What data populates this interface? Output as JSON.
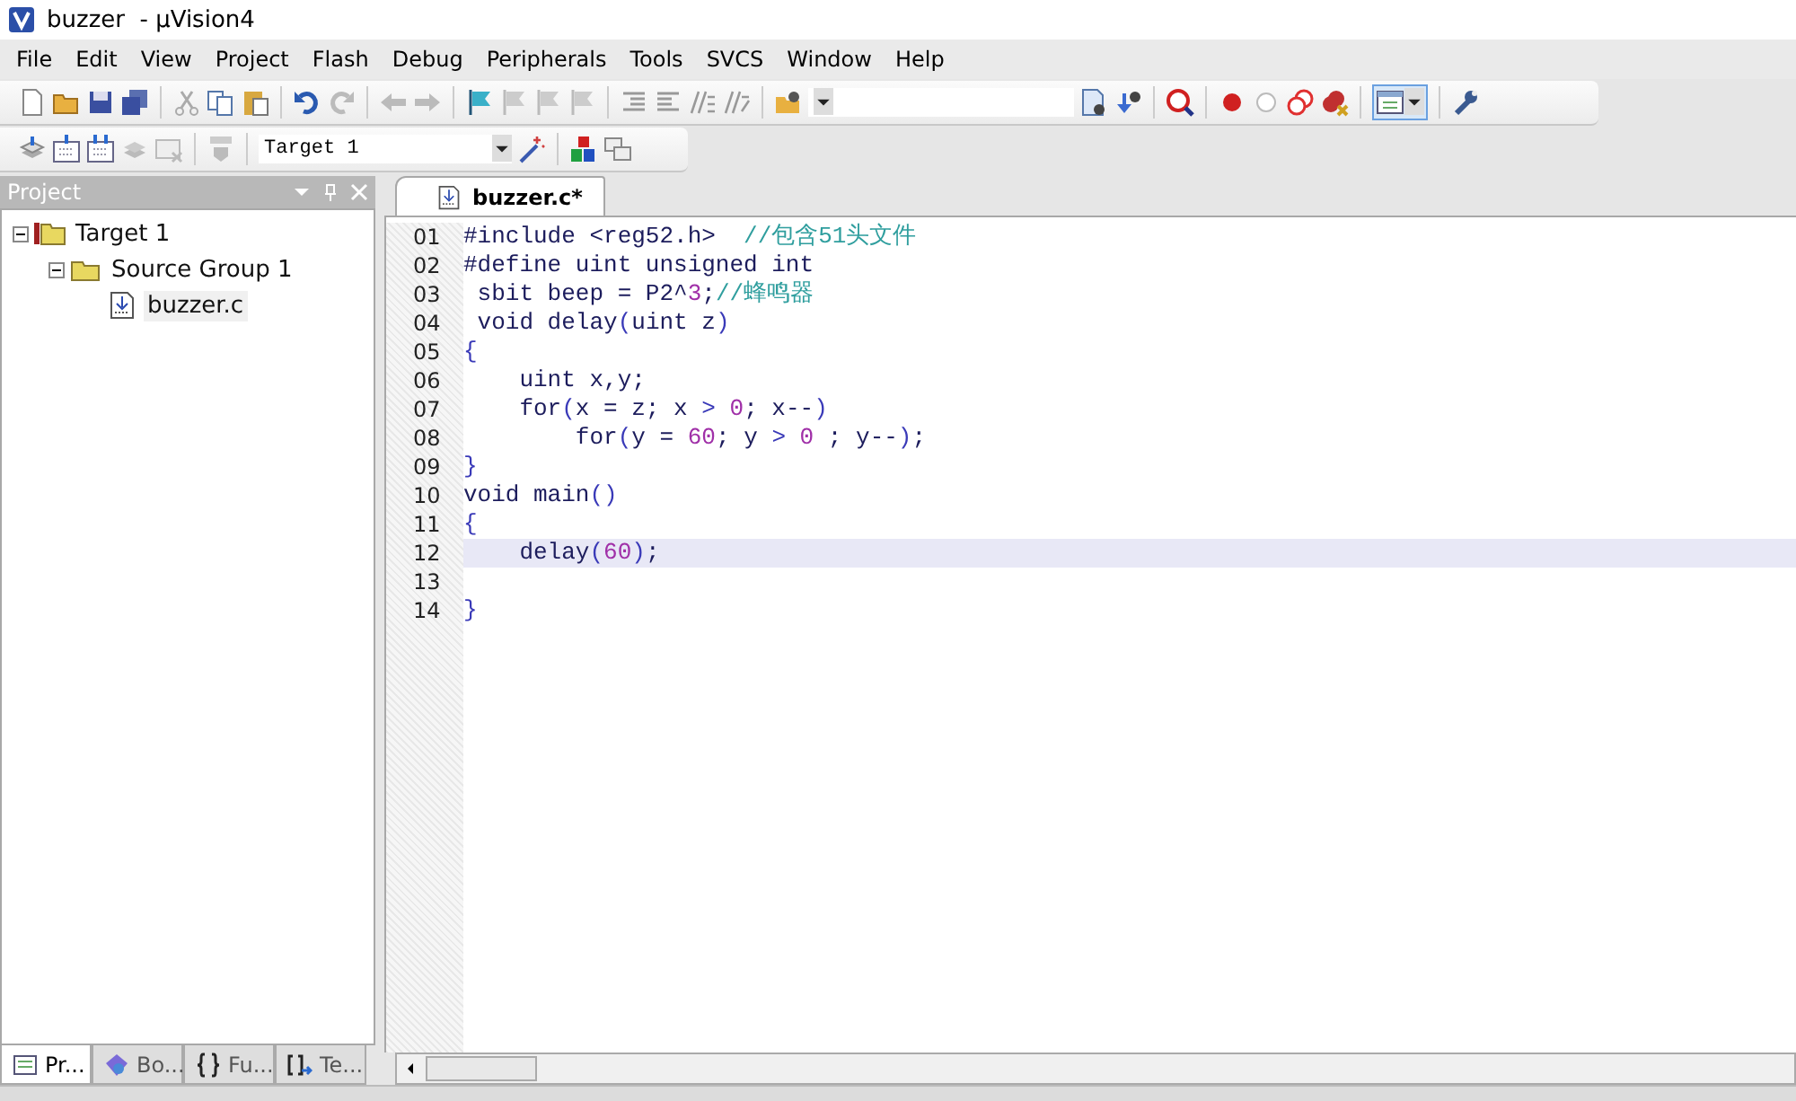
{
  "window": {
    "title": "buzzer  - µVision4"
  },
  "menu": [
    {
      "label": "File"
    },
    {
      "label": "Edit"
    },
    {
      "label": "View"
    },
    {
      "label": "Project"
    },
    {
      "label": "Flash"
    },
    {
      "label": "Debug"
    },
    {
      "label": "Peripherals"
    },
    {
      "label": "Tools"
    },
    {
      "label": "SVCS"
    },
    {
      "label": "Window"
    },
    {
      "label": "Help"
    }
  ],
  "toolbar": {
    "target_select": "Target 1"
  },
  "project_panel": {
    "title": "Project",
    "tree": [
      {
        "label": "Target 1",
        "kind": "target",
        "expanded": true,
        "children": [
          {
            "label": "Source Group 1",
            "kind": "group",
            "expanded": true,
            "children": [
              {
                "label": "buzzer.c",
                "kind": "file",
                "selected": true
              }
            ]
          }
        ]
      }
    ],
    "tabs": [
      {
        "label": "Pr...",
        "kind": "project",
        "selected": true
      },
      {
        "label": "Bo...",
        "kind": "books",
        "selected": false
      },
      {
        "label": "Fu...",
        "kind": "functions",
        "selected": false
      },
      {
        "label": "Te...",
        "kind": "templates",
        "selected": false
      }
    ]
  },
  "editor": {
    "tabs": [
      {
        "label": "buzzer.c*",
        "selected": true
      }
    ],
    "lines": [
      {
        "number": "01",
        "current": false,
        "tokens": [
          {
            "t": "#include <reg52.h>  ",
            "kind": "code"
          },
          {
            "t": "//包含51头文件",
            "kind": "comment"
          }
        ]
      },
      {
        "number": "02",
        "current": false,
        "tokens": [
          {
            "t": "#define uint unsigned int",
            "kind": "code"
          }
        ]
      },
      {
        "number": "03",
        "current": false,
        "tokens": [
          {
            "t": " sbit beep = P2^",
            "kind": "code"
          },
          {
            "t": "3",
            "kind": "number"
          },
          {
            "t": ";",
            "kind": "code"
          },
          {
            "t": "//蜂鸣器",
            "kind": "comment"
          }
        ]
      },
      {
        "number": "04",
        "current": false,
        "tokens": [
          {
            "t": " void delay",
            "kind": "code"
          },
          {
            "t": "(",
            "kind": "op"
          },
          {
            "t": "uint z",
            "kind": "code"
          },
          {
            "t": ")",
            "kind": "op"
          }
        ]
      },
      {
        "number": "05",
        "current": false,
        "tokens": [
          {
            "t": "{",
            "kind": "op"
          }
        ]
      },
      {
        "number": "06",
        "current": false,
        "tokens": [
          {
            "t": "    uint x,y;",
            "kind": "code"
          }
        ]
      },
      {
        "number": "07",
        "current": false,
        "tokens": [
          {
            "t": "    for",
            "kind": "code"
          },
          {
            "t": "(",
            "kind": "op"
          },
          {
            "t": "x = z; x ",
            "kind": "code"
          },
          {
            "t": "> ",
            "kind": "op"
          },
          {
            "t": "0",
            "kind": "number"
          },
          {
            "t": "; x--",
            "kind": "code"
          },
          {
            "t": ")",
            "kind": "op"
          }
        ]
      },
      {
        "number": "08",
        "current": false,
        "tokens": [
          {
            "t": "        for",
            "kind": "code"
          },
          {
            "t": "(",
            "kind": "op"
          },
          {
            "t": "y = ",
            "kind": "code"
          },
          {
            "t": "60",
            "kind": "number"
          },
          {
            "t": "; y ",
            "kind": "code"
          },
          {
            "t": "> ",
            "kind": "op"
          },
          {
            "t": "0",
            "kind": "number"
          },
          {
            "t": " ; y--",
            "kind": "code"
          },
          {
            "t": ")",
            "kind": "op"
          },
          {
            "t": ";",
            "kind": "code"
          }
        ]
      },
      {
        "number": "09",
        "current": false,
        "tokens": [
          {
            "t": "}",
            "kind": "op"
          }
        ]
      },
      {
        "number": "10",
        "current": false,
        "tokens": [
          {
            "t": "void main",
            "kind": "code"
          },
          {
            "t": "()",
            "kind": "op"
          }
        ]
      },
      {
        "number": "11",
        "current": false,
        "tokens": [
          {
            "t": "{",
            "kind": "op"
          }
        ]
      },
      {
        "number": "12",
        "current": true,
        "tokens": [
          {
            "t": "    delay",
            "kind": "code"
          },
          {
            "t": "(",
            "kind": "op"
          },
          {
            "t": "60",
            "kind": "number"
          },
          {
            "t": ")",
            "kind": "op"
          },
          {
            "t": ";",
            "kind": "code"
          }
        ]
      },
      {
        "number": "13",
        "current": false
      },
      {
        "number": "14",
        "current": false,
        "tokens": [
          {
            "t": "}",
            "kind": "op"
          }
        ]
      }
    ]
  }
}
